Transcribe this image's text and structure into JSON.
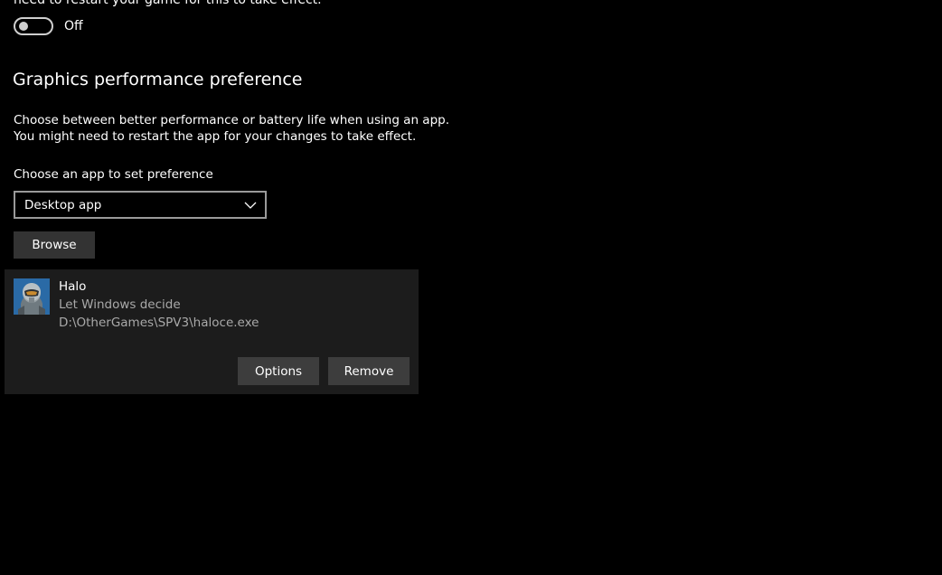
{
  "top_cut_text": "need to restart your game for this to take effect.",
  "toggle": {
    "state_label": "Off",
    "on": false
  },
  "graphics": {
    "title": "Graphics performance preference",
    "description_line1": "Choose between better performance or battery life when using an app.",
    "description_line2": "You might need to restart the app for your changes to take effect.",
    "choose_label": "Choose an app to set preference",
    "dropdown_value": "Desktop app",
    "browse_label": "Browse"
  },
  "app_card": {
    "icon": "halo-app-icon",
    "name": "Halo",
    "preference": "Let Windows decide",
    "path": "D:\\OtherGames\\SPV3\\haloce.exe",
    "options_label": "Options",
    "remove_label": "Remove"
  },
  "colors": {
    "background": "#000000",
    "card": "#1c1c1c",
    "button": "#333333",
    "secondary_text": "#a9a9a9"
  }
}
